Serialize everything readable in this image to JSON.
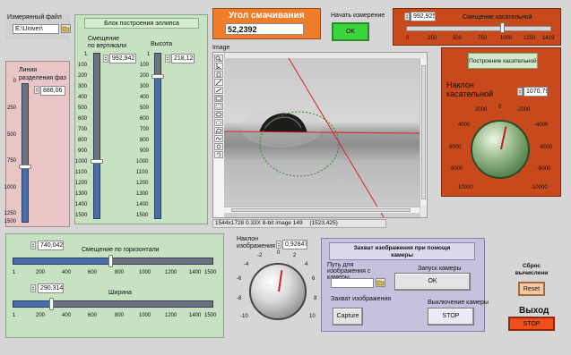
{
  "file": {
    "label": "Измерянный файл",
    "path": "E:\\Univer\\"
  },
  "phase": {
    "label": "Линия разделения фаз",
    "value": "886,06",
    "ticks": [
      "0",
      "250",
      "500",
      "750",
      "1000",
      "1250",
      "1500"
    ],
    "fraction": 0.59
  },
  "ellipse": {
    "title": "Блок построения эллипса",
    "vshift": {
      "label": "Смещение по вертикали",
      "value": "992,942",
      "fraction": 0.66
    },
    "height": {
      "label": "Высота",
      "value": "218,125",
      "fraction": 0.15
    },
    "ticks": [
      "1",
      "100",
      "200",
      "300",
      "400",
      "500",
      "600",
      "700",
      "800",
      "900",
      "1000",
      "1100",
      "1200",
      "1300",
      "1400",
      "1500"
    ]
  },
  "angle": {
    "label": "Угол смачивания",
    "value": "52,2392"
  },
  "start": {
    "label": "Начать измерение",
    "button": "OK"
  },
  "tangent_shift": {
    "label": "Смещение касательной",
    "value": "992,925",
    "fraction": 0.7,
    "ticks": [
      "0",
      "250",
      "500",
      "750",
      "1000",
      "1250",
      "1419"
    ]
  },
  "tangent_build": {
    "label": "Построение касательной"
  },
  "slope_tangent": {
    "label": "Наклон касательной",
    "value": "1070,79",
    "ticks": [
      "0",
      "2000",
      "-2000",
      "4000",
      "-4000",
      "6000",
      "-6000",
      "8000",
      "-8000",
      "10000",
      "-10000"
    ]
  },
  "image": {
    "label": "Image",
    "status": "1544x1728 0.33X 8-bit image 149",
    "coords": "(1523,425)"
  },
  "hshift": {
    "label": "Смещение по горизонтали",
    "value": "740,042",
    "fraction": 0.49,
    "ticks": [
      "1",
      "200",
      "400",
      "600",
      "800",
      "1000",
      "1200",
      "1400",
      "1500"
    ]
  },
  "width": {
    "label": "Ширина",
    "value": "290,314",
    "fraction": 0.19,
    "ticks": [
      "1",
      "200",
      "400",
      "600",
      "800",
      "1000",
      "1200",
      "1400",
      "1500"
    ]
  },
  "slope_image": {
    "label": "Наклон изображения",
    "value": "0,92847",
    "ticks": [
      "-10",
      "-8",
      "-6",
      "-4",
      "-2",
      "0",
      "2",
      "4",
      "6",
      "8",
      "10"
    ]
  },
  "capture": {
    "title": "Захват изображения при помощи камеры",
    "path_label": "Путь для изображения с камеры",
    "path_value": "",
    "start_label": "Запуск камеры",
    "start_button": "OK",
    "capture_label": "Захват изображения",
    "capture_button": "Capture",
    "off_label": "Выключение камеры",
    "stop_button": "STOP"
  },
  "reset": {
    "label": "Сброс вычислени",
    "button": "Reset"
  },
  "exit": {
    "label": "Выход",
    "button": "STOP"
  },
  "icons": [
    "folder-icon",
    "zoom-icon",
    "pointer-icon",
    "hand-icon",
    "pencil-icon",
    "line-icon",
    "rectangle-icon",
    "oval-icon",
    "polygon-icon",
    "freehand-icon",
    "rotate-icon"
  ],
  "colors": {
    "panel_pink": "#e8c6c6",
    "panel_green": "#c6e2c0",
    "panel_orange": "#c84a1c",
    "panel_lilac": "#c6c2de",
    "angle_orange": "#ef7d2a",
    "button_green": "#3cd43c",
    "stop_red": "#f04f1c",
    "slider_blue": "#4a6fa8"
  }
}
